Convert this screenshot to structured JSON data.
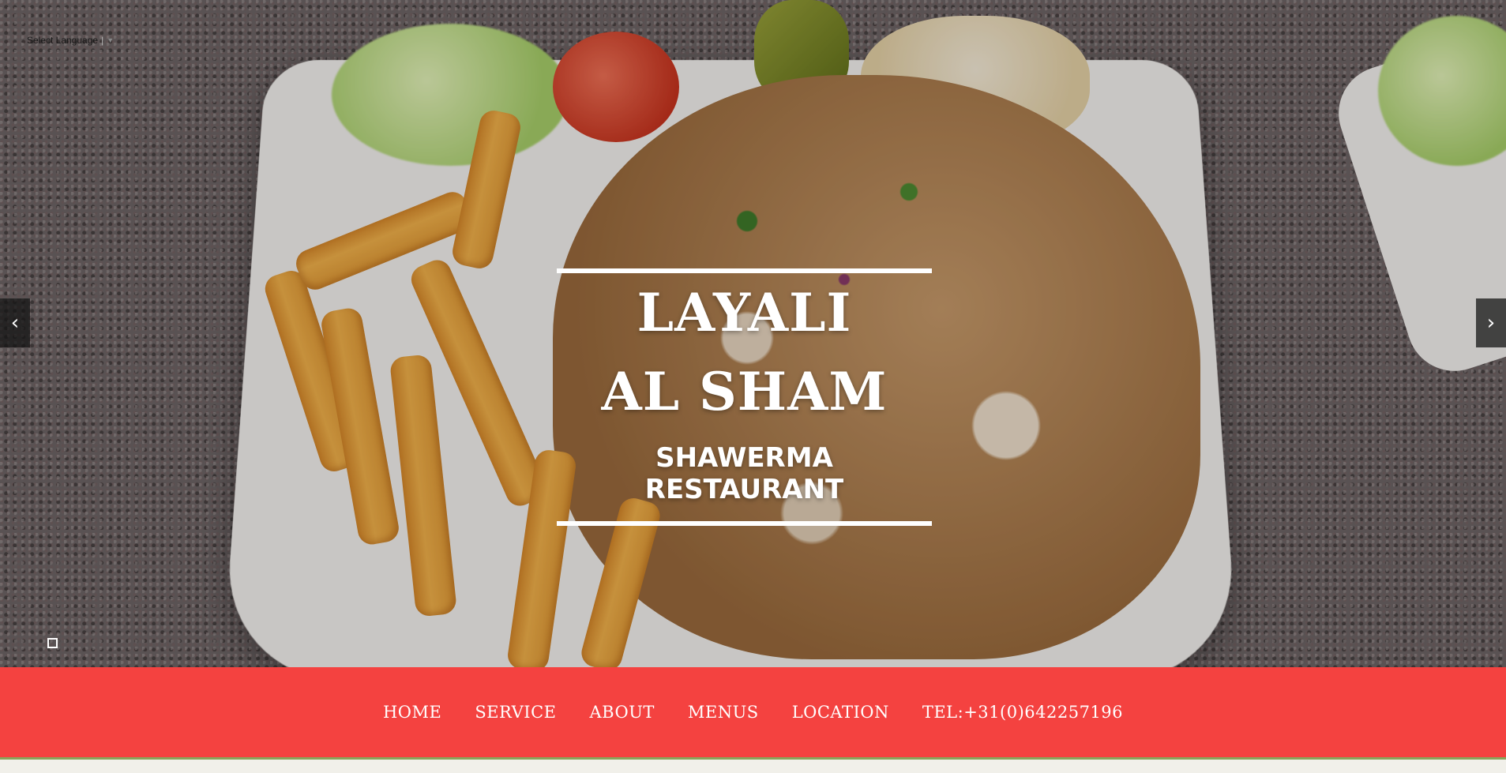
{
  "language_selector": {
    "label": "Select Language",
    "separator": "|",
    "caret": "▼"
  },
  "hero": {
    "title": "LAYALI AL SHAM",
    "subtitle": "SHAWERMA RESTAURANT",
    "prev_arrow": "‹",
    "next_arrow": "›",
    "image_description_icon": "shawarma-plate-photo"
  },
  "navbar": {
    "items": [
      {
        "label": "HOME"
      },
      {
        "label": "SERVICE"
      },
      {
        "label": "ABOUT"
      },
      {
        "label": "MENUS"
      },
      {
        "label": "LOCATION"
      },
      {
        "label": "TEL:+31(0)642257196"
      }
    ]
  },
  "colors": {
    "nav_background": "#f44240",
    "nav_text": "#ffffff",
    "accent_underline": "#8aa45a"
  }
}
